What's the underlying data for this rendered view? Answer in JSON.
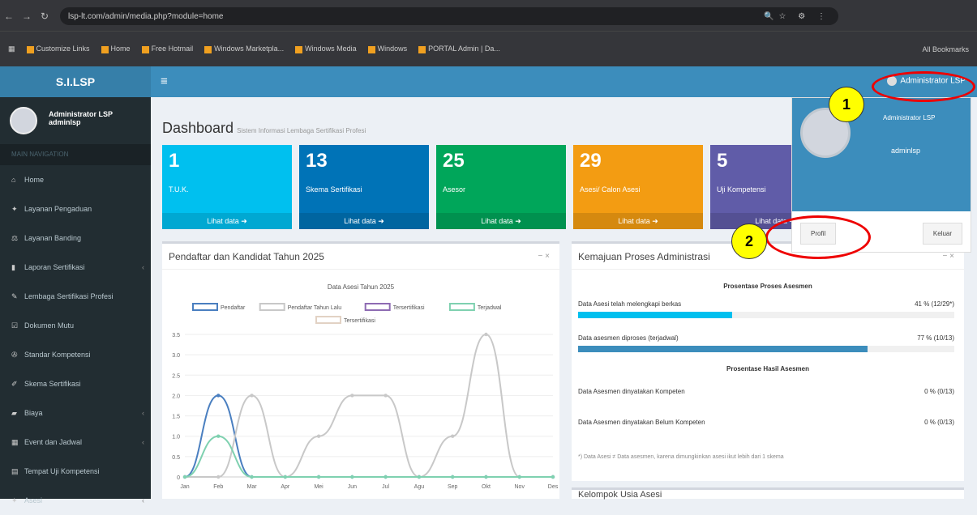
{
  "browser": {
    "url": "lsp-lt.com/admin/media.php?module=home",
    "bookmarks": [
      "Customize Links",
      "Home",
      "Free Hotmail",
      "Windows Marketpla...",
      "Windows Media",
      "Windows",
      "PORTAL Admin | Da..."
    ],
    "all_bookmarks": "All Bookmarks"
  },
  "header": {
    "logo": "S.I.LSP",
    "menu_icon": "≡",
    "admin_name": "Administrator LSP"
  },
  "sidebar": {
    "user_name": "Administrator LSP",
    "user_login": "adminlsp",
    "nav_header": "MAIN NAVIGATION",
    "items": [
      {
        "label": "Home",
        "icon": "home-icon",
        "glyph": "⌂"
      },
      {
        "label": "Layanan Pengaduan",
        "icon": "users-icon",
        "glyph": "✦"
      },
      {
        "label": "Layanan Banding",
        "icon": "scale-icon",
        "glyph": "⚖"
      },
      {
        "label": "Laporan Sertifikasi",
        "icon": "book-icon",
        "glyph": "▮"
      },
      {
        "label": "Lembaga Sertifikasi Profesi",
        "icon": "graduation-icon",
        "glyph": "✎"
      },
      {
        "label": "Dokumen Mutu",
        "icon": "check-icon",
        "glyph": "☑"
      },
      {
        "label": "Standar Kompetensi",
        "icon": "tools-icon",
        "glyph": "✇"
      },
      {
        "label": "Skema Sertifikasi",
        "icon": "edit-icon",
        "glyph": "✐"
      },
      {
        "label": "Biaya",
        "icon": "folder-icon",
        "glyph": "▰"
      },
      {
        "label": "Event dan Jadwal",
        "icon": "calendar-icon",
        "glyph": "▦"
      },
      {
        "label": "Tempat Uji Kompetensi",
        "icon": "building-icon",
        "glyph": "▤"
      },
      {
        "label": "Asesi",
        "icon": "user-icon",
        "glyph": "✦"
      }
    ]
  },
  "page": {
    "title": "Dashboard",
    "subtitle": "Sistem Informasi Lembaga Sertifikasi Profesi"
  },
  "stat_boxes": [
    {
      "num": "1",
      "label": "T.U.K.",
      "link": "Lihat data ➜",
      "color": "#00c0ef"
    },
    {
      "num": "13",
      "label": "Skema Sertifikasi",
      "link": "Lihat data ➜",
      "color": "#0073b7"
    },
    {
      "num": "25",
      "label": "Asesor",
      "link": "Lihat data ➜",
      "color": "#00a65a"
    },
    {
      "num": "29",
      "label": "Asesi/ Calon Asesi",
      "link": "Lihat data ➜",
      "color": "#f39c12"
    },
    {
      "num": "5",
      "label": "Uji Kompetensi",
      "link": "Lihat data ➜",
      "color": "#605ca8"
    }
  ],
  "chart_panel": {
    "title": "Pendaftar dan Kandidat Tahun 2025",
    "tools": "−  ×"
  },
  "chart_data": {
    "type": "line",
    "title": "Data Asesi Tahun 2025",
    "categories": [
      "Jan",
      "Feb",
      "Mar",
      "Apr",
      "Mei",
      "Jun",
      "Jul",
      "Agu",
      "Sep",
      "Okt",
      "Nov",
      "Des"
    ],
    "ylim": [
      0,
      3.5
    ],
    "yticks": [
      "0",
      "0.5",
      "1.0",
      "1.5",
      "2.0",
      "2.5",
      "3.0",
      "3.5"
    ],
    "series": [
      {
        "name": "Pendaftar",
        "color": "#4a7fc0",
        "values": [
          0,
          2,
          0,
          0,
          0,
          0,
          0,
          0,
          0,
          0,
          0,
          0
        ]
      },
      {
        "name": "Pendaftar Tahun Lalu",
        "color": "#c8c8c8",
        "values": [
          0,
          0,
          2,
          0,
          1,
          2,
          2,
          0,
          1,
          3.5,
          0,
          0
        ]
      },
      {
        "name": "Tersertifikasi",
        "color": "#8e6bb3",
        "values": [
          0,
          0,
          0,
          0,
          0,
          0,
          0,
          0,
          0,
          0,
          0,
          0
        ]
      },
      {
        "name": "Terjadwal",
        "color": "#7fd1b0",
        "values": [
          0,
          1,
          0,
          0,
          0,
          0,
          0,
          0,
          0,
          0,
          0,
          0
        ]
      },
      {
        "name": "Tersertifikasi",
        "color": "#e2d2c4",
        "values": [
          0,
          0,
          0,
          0,
          0,
          0,
          0,
          0,
          0,
          0,
          0,
          0
        ]
      }
    ]
  },
  "progress_panel": {
    "title": "Kemajuan Proses Administrasi",
    "tools": "−  ×",
    "sec1": "Prosentase Proses Asesmen",
    "sec2": "Prosentase Hasil Asesmen",
    "rows": [
      {
        "label": "Data Asesi telah melengkapi berkas",
        "value": "41 % (12/29*)",
        "pct": 0.41,
        "color": "#00c0ef"
      },
      {
        "label": "Data asesmen diproses (terjadwal)",
        "value": "77 % (10/13)",
        "pct": 0.77,
        "color": "#3c8dbc"
      },
      {
        "label": "Data Asesmen dinyatakan Kompeten",
        "value": "0 % (0/13)",
        "pct": 0,
        "color": "#00a65a"
      },
      {
        "label": "Data Asesmen dinyatakan Belum Kompeten",
        "value": "0 % (0/13)",
        "pct": 0,
        "color": "#dd4b39"
      }
    ],
    "note": "*) Data Asesi ≠ Data asesmen, karena dimungkinkan asesi ikut lebih dari 1 skema"
  },
  "bottom_panel": {
    "title": "Kelompok Usia Asesi"
  },
  "dropdown": {
    "name": "Administrator LSP",
    "login": "adminlsp",
    "profile_btn": "Profil",
    "logout_btn": "Keluar"
  },
  "annotations": {
    "badge1": "1",
    "badge2": "2"
  }
}
